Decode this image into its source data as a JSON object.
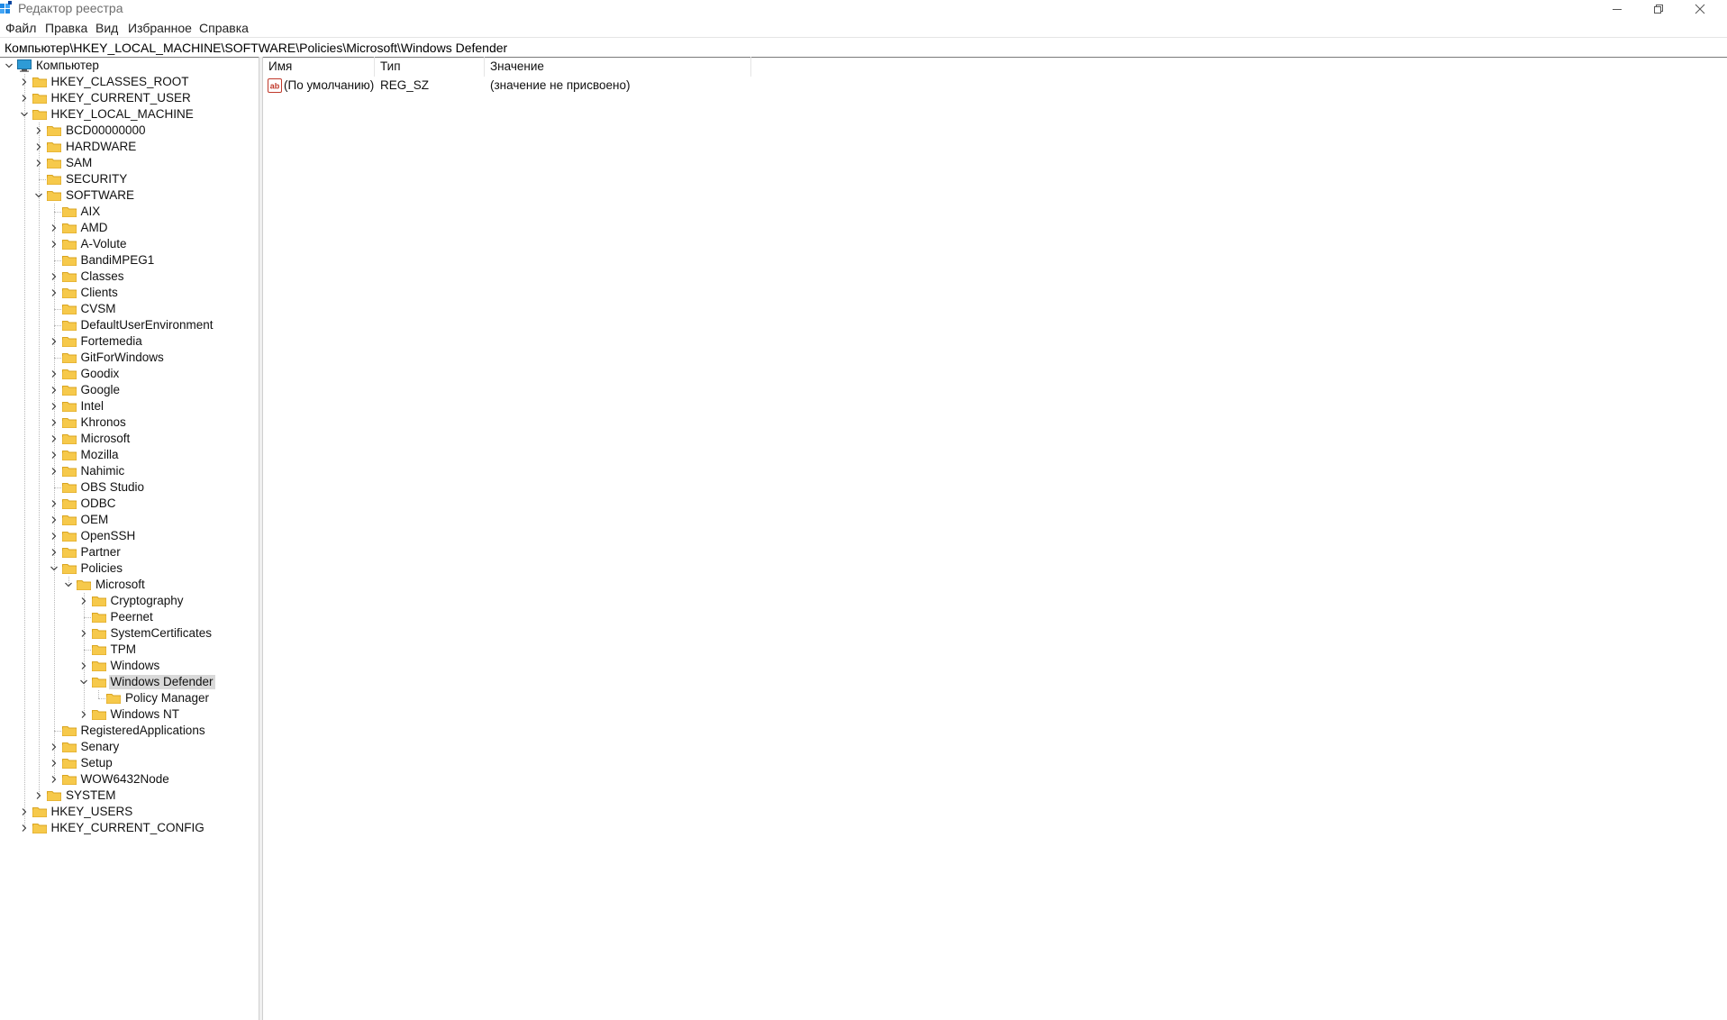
{
  "window": {
    "title": "Редактор реестра"
  },
  "menu": [
    "Файл",
    "Правка",
    "Вид",
    "Избранное",
    "Справка"
  ],
  "address": "Компьютер\\HKEY_LOCAL_MACHINE\\SOFTWARE\\Policies\\Microsoft\\Windows Defender",
  "tree": [
    {
      "label": "Компьютер",
      "depth": 0,
      "expander": "expanded",
      "icon": "computer-icon"
    },
    {
      "label": "HKEY_CLASSES_ROOT",
      "depth": 1,
      "expander": "collapsed",
      "icon": "folder-icon"
    },
    {
      "label": "HKEY_CURRENT_USER",
      "depth": 1,
      "expander": "collapsed",
      "icon": "folder-icon"
    },
    {
      "label": "HKEY_LOCAL_MACHINE",
      "depth": 1,
      "expander": "expanded",
      "icon": "folder-icon"
    },
    {
      "label": "BCD00000000",
      "depth": 2,
      "expander": "collapsed",
      "icon": "folder-icon"
    },
    {
      "label": "HARDWARE",
      "depth": 2,
      "expander": "collapsed",
      "icon": "folder-icon"
    },
    {
      "label": "SAM",
      "depth": 2,
      "expander": "collapsed",
      "icon": "folder-icon"
    },
    {
      "label": "SECURITY",
      "depth": 2,
      "expander": "none",
      "icon": "folder-icon"
    },
    {
      "label": "SOFTWARE",
      "depth": 2,
      "expander": "expanded",
      "icon": "folder-icon"
    },
    {
      "label": "AIX",
      "depth": 3,
      "expander": "none",
      "icon": "folder-icon"
    },
    {
      "label": "AMD",
      "depth": 3,
      "expander": "collapsed",
      "icon": "folder-icon"
    },
    {
      "label": "A-Volute",
      "depth": 3,
      "expander": "collapsed",
      "icon": "folder-icon"
    },
    {
      "label": "BandiMPEG1",
      "depth": 3,
      "expander": "none",
      "icon": "folder-icon"
    },
    {
      "label": "Classes",
      "depth": 3,
      "expander": "collapsed",
      "icon": "folder-icon"
    },
    {
      "label": "Clients",
      "depth": 3,
      "expander": "collapsed",
      "icon": "folder-icon"
    },
    {
      "label": "CVSM",
      "depth": 3,
      "expander": "none",
      "icon": "folder-icon"
    },
    {
      "label": "DefaultUserEnvironment",
      "depth": 3,
      "expander": "none",
      "icon": "folder-icon"
    },
    {
      "label": "Fortemedia",
      "depth": 3,
      "expander": "collapsed",
      "icon": "folder-icon"
    },
    {
      "label": "GitForWindows",
      "depth": 3,
      "expander": "none",
      "icon": "folder-icon"
    },
    {
      "label": "Goodix",
      "depth": 3,
      "expander": "collapsed",
      "icon": "folder-icon"
    },
    {
      "label": "Google",
      "depth": 3,
      "expander": "collapsed",
      "icon": "folder-icon"
    },
    {
      "label": "Intel",
      "depth": 3,
      "expander": "collapsed",
      "icon": "folder-icon"
    },
    {
      "label": "Khronos",
      "depth": 3,
      "expander": "collapsed",
      "icon": "folder-icon"
    },
    {
      "label": "Microsoft",
      "depth": 3,
      "expander": "collapsed",
      "icon": "folder-icon"
    },
    {
      "label": "Mozilla",
      "depth": 3,
      "expander": "collapsed",
      "icon": "folder-icon"
    },
    {
      "label": "Nahimic",
      "depth": 3,
      "expander": "collapsed",
      "icon": "folder-icon"
    },
    {
      "label": "OBS Studio",
      "depth": 3,
      "expander": "none",
      "icon": "folder-icon"
    },
    {
      "label": "ODBC",
      "depth": 3,
      "expander": "collapsed",
      "icon": "folder-icon"
    },
    {
      "label": "OEM",
      "depth": 3,
      "expander": "collapsed",
      "icon": "folder-icon"
    },
    {
      "label": "OpenSSH",
      "depth": 3,
      "expander": "collapsed",
      "icon": "folder-icon"
    },
    {
      "label": "Partner",
      "depth": 3,
      "expander": "collapsed",
      "icon": "folder-icon"
    },
    {
      "label": "Policies",
      "depth": 3,
      "expander": "expanded",
      "icon": "folder-icon"
    },
    {
      "label": "Microsoft",
      "depth": 4,
      "expander": "expanded",
      "icon": "folder-icon"
    },
    {
      "label": "Cryptography",
      "depth": 5,
      "expander": "collapsed",
      "icon": "folder-icon"
    },
    {
      "label": "Peernet",
      "depth": 5,
      "expander": "none",
      "icon": "folder-icon"
    },
    {
      "label": "SystemCertificates",
      "depth": 5,
      "expander": "collapsed",
      "icon": "folder-icon"
    },
    {
      "label": "TPM",
      "depth": 5,
      "expander": "none",
      "icon": "folder-icon"
    },
    {
      "label": "Windows",
      "depth": 5,
      "expander": "collapsed",
      "icon": "folder-icon"
    },
    {
      "label": "Windows Defender",
      "depth": 5,
      "expander": "expanded",
      "icon": "folder-icon",
      "selected": true
    },
    {
      "label": "Policy Manager",
      "depth": 6,
      "expander": "none",
      "icon": "folder-icon"
    },
    {
      "label": "Windows NT",
      "depth": 5,
      "expander": "collapsed",
      "icon": "folder-icon"
    },
    {
      "label": "RegisteredApplications",
      "depth": 3,
      "expander": "none",
      "icon": "folder-icon"
    },
    {
      "label": "Senary",
      "depth": 3,
      "expander": "collapsed",
      "icon": "folder-icon"
    },
    {
      "label": "Setup",
      "depth": 3,
      "expander": "collapsed",
      "icon": "folder-icon"
    },
    {
      "label": "WOW6432Node",
      "depth": 3,
      "expander": "collapsed",
      "icon": "folder-icon"
    },
    {
      "label": "SYSTEM",
      "depth": 2,
      "expander": "collapsed",
      "icon": "folder-icon"
    },
    {
      "label": "HKEY_USERS",
      "depth": 1,
      "expander": "collapsed",
      "icon": "folder-icon"
    },
    {
      "label": "HKEY_CURRENT_CONFIG",
      "depth": 1,
      "expander": "collapsed",
      "icon": "folder-icon"
    }
  ],
  "list": {
    "columns": [
      "Имя",
      "Тип",
      "Значение"
    ],
    "rows": [
      {
        "name": "(По умолчанию)",
        "type": "REG_SZ",
        "value": "(значение не присвоено)",
        "icon": "string-value-icon"
      }
    ]
  },
  "colors": {
    "folder": "#f6c94b",
    "folder_edge": "#d9a420",
    "selection": "#d9d9d9",
    "string_icon": "#c0392b"
  }
}
